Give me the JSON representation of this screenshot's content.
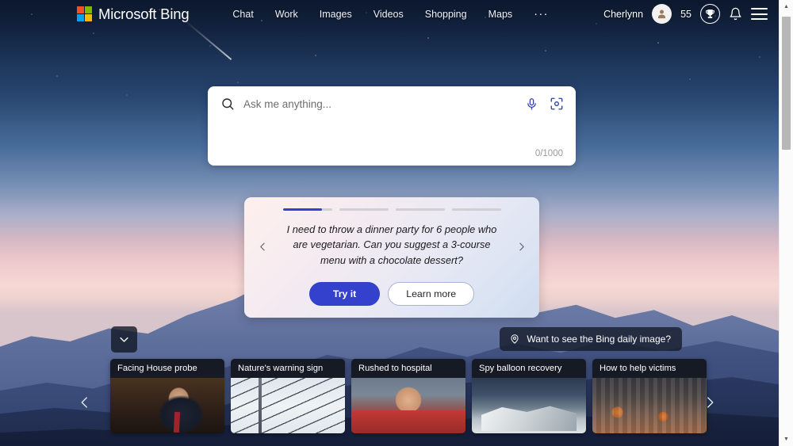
{
  "header": {
    "brand": "Microsoft Bing",
    "logo_icon": "microsoft-logo-icon",
    "nav": [
      {
        "label": "Chat"
      },
      {
        "label": "Work"
      },
      {
        "label": "Images"
      },
      {
        "label": "Videos"
      },
      {
        "label": "Shopping"
      },
      {
        "label": "Maps"
      }
    ],
    "more_label": "···",
    "user_name": "Cherlynn",
    "avatar_icon": "avatar-icon",
    "rewards_count": "55",
    "rewards_icon": "trophy-icon",
    "notifications_icon": "bell-icon",
    "menu_icon": "hamburger-menu-icon"
  },
  "search": {
    "placeholder": "Ask me anything...",
    "value": "",
    "counter": "0/1000",
    "search_icon": "search-icon",
    "mic_icon": "microphone-icon",
    "camera_icon": "visual-search-icon"
  },
  "suggestion": {
    "prompt": "I need to throw a dinner party for 6 people who are vegetarian. Can you suggest a 3-course menu with a chocolate dessert?",
    "try_label": "Try it",
    "learn_label": "Learn more",
    "prev_icon": "chevron-left-icon",
    "next_icon": "chevron-right-icon",
    "progress": [
      {
        "percent": 80,
        "active": true
      },
      {
        "percent": 0,
        "active": false
      },
      {
        "percent": 0,
        "active": false
      },
      {
        "percent": 0,
        "active": false
      }
    ],
    "accent_color": "#3341cc"
  },
  "daily_image": {
    "label": "Want to see the Bing daily image?",
    "pin_icon": "location-pin-icon"
  },
  "expand_button": {
    "icon": "chevron-down-icon"
  },
  "news": {
    "prev_icon": "chevron-left-icon",
    "next_icon": "chevron-right-icon",
    "cards": [
      {
        "title": "Facing House probe",
        "thumb": "thumb-hearing"
      },
      {
        "title": "Nature's warning sign",
        "thumb": "thumb-wires"
      },
      {
        "title": "Rushed to hospital",
        "thumb": "thumb-stadium"
      },
      {
        "title": "Spy balloon recovery",
        "thumb": "thumb-balloon"
      },
      {
        "title": "How to help victims",
        "thumb": "thumb-crowd"
      }
    ]
  },
  "scrollbar": {
    "up_icon": "scroll-up-arrow-icon",
    "down_icon": "scroll-down-arrow-icon"
  }
}
